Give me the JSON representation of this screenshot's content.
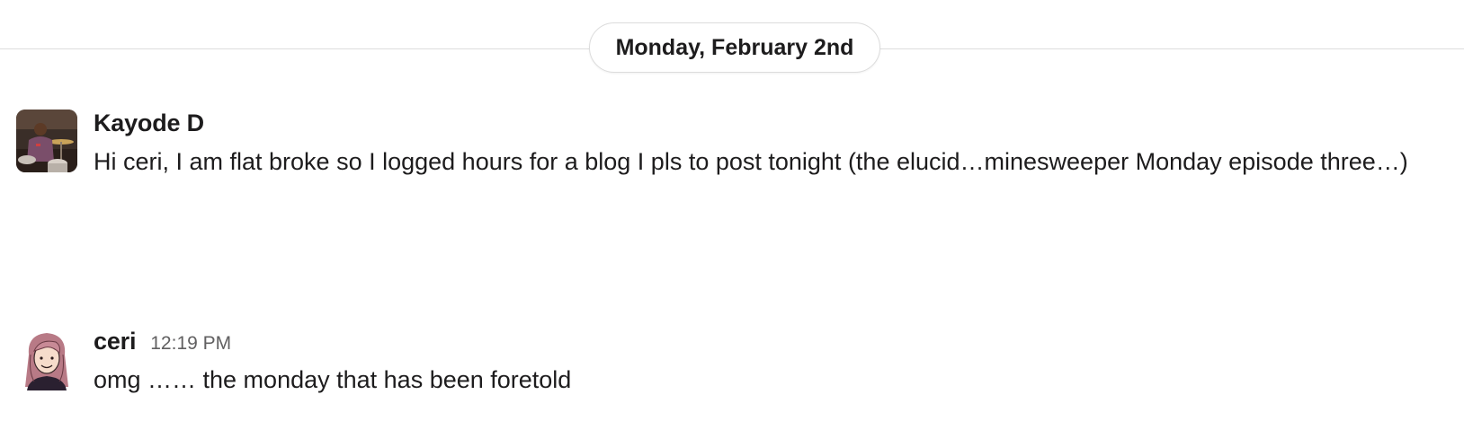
{
  "channel": {
    "date_divider": "Monday, February 2nd"
  },
  "messages": [
    {
      "author": "Kayode D",
      "timestamp": "",
      "text": "Hi ceri, I am flat broke so I logged hours for a blog I pls to post tonight (the elucid…minesweeper Monday episode three…)",
      "avatar_icon": "drummer-photo-avatar"
    },
    {
      "author": "ceri",
      "timestamp": "12:19 PM",
      "text": "omg …… the monday that has been foretold",
      "avatar_icon": "illustrated-woman-avatar"
    }
  ],
  "colors": {
    "text_primary": "#1d1c1d",
    "text_secondary": "#616061",
    "divider": "#dddddd"
  }
}
